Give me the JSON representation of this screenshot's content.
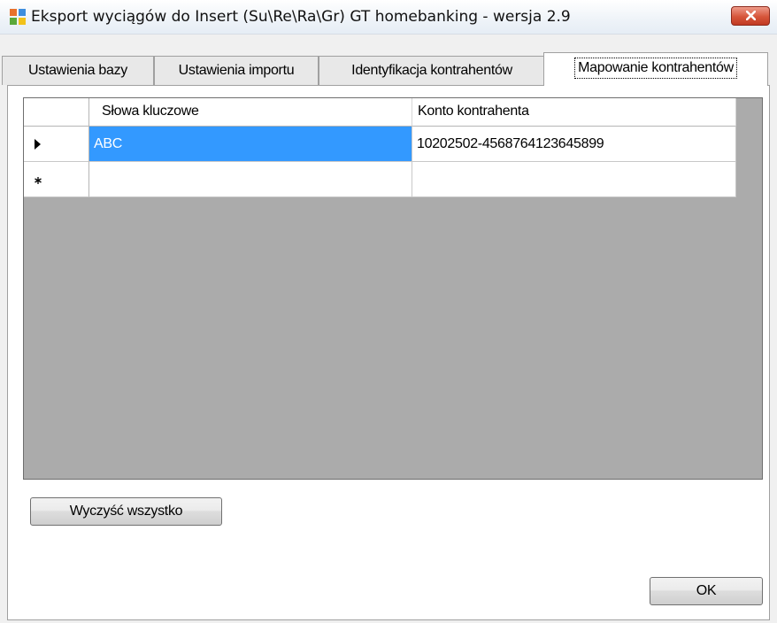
{
  "window": {
    "title": "Eksport wyciągów do Insert (Su\\Re\\Ra\\Gr) GT homebanking - wersja 2.9"
  },
  "tabs": [
    {
      "label": "Ustawienia bazy"
    },
    {
      "label": "Ustawienia importu"
    },
    {
      "label": "Identyfikacja kontrahentów"
    },
    {
      "label": "Mapowanie kontrahentów"
    }
  ],
  "grid": {
    "columns": [
      "Słowa kluczowe",
      "Konto kontrahenta"
    ],
    "rows": [
      {
        "indicator": "current-row",
        "keywords": "ABC",
        "account": "10202502-4568764123645899"
      },
      {
        "indicator": "new-row",
        "keywords": "",
        "account": ""
      }
    ]
  },
  "buttons": {
    "clear_all": "Wyczyść wszystko",
    "ok": "OK"
  },
  "colors": {
    "selection": "#3399ff",
    "grid_background": "#ababab",
    "close_button": "#d6553a"
  },
  "icons": {
    "app": "window-app-icon",
    "close": "close-icon",
    "current_row": "row-arrow-icon",
    "new_row": "new-row-asterisk-icon"
  }
}
